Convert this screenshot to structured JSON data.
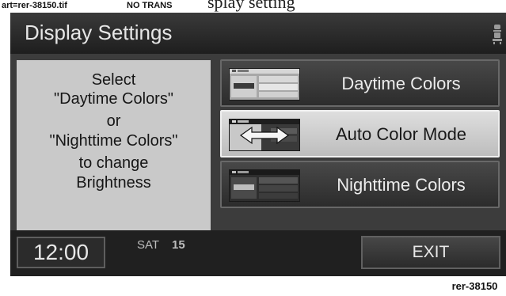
{
  "header_strip": {
    "art_label": "art=rer-38150.tif",
    "trans_label": "NO TRANS",
    "caption_fragment": "splay setting"
  },
  "screen": {
    "title": "Display Settings",
    "info_text": {
      "line1": "Select",
      "line2": "\"Daytime Colors\"",
      "line3": "or",
      "line4": "\"Nighttime Colors\"",
      "line5": "to change",
      "line6": "Brightness"
    },
    "options": [
      {
        "label": "Daytime Colors",
        "selected": false
      },
      {
        "label": "Auto Color Mode",
        "selected": true
      },
      {
        "label": "Nighttime Colors",
        "selected": false
      }
    ],
    "clock": "12:00",
    "day": "SAT",
    "date": "15",
    "exit_label": "EXIT"
  },
  "reference_id": "rer-38150",
  "icons": {
    "top_right": "seat-icon",
    "auto_thumb_arrow": "double-arrow-icon"
  }
}
